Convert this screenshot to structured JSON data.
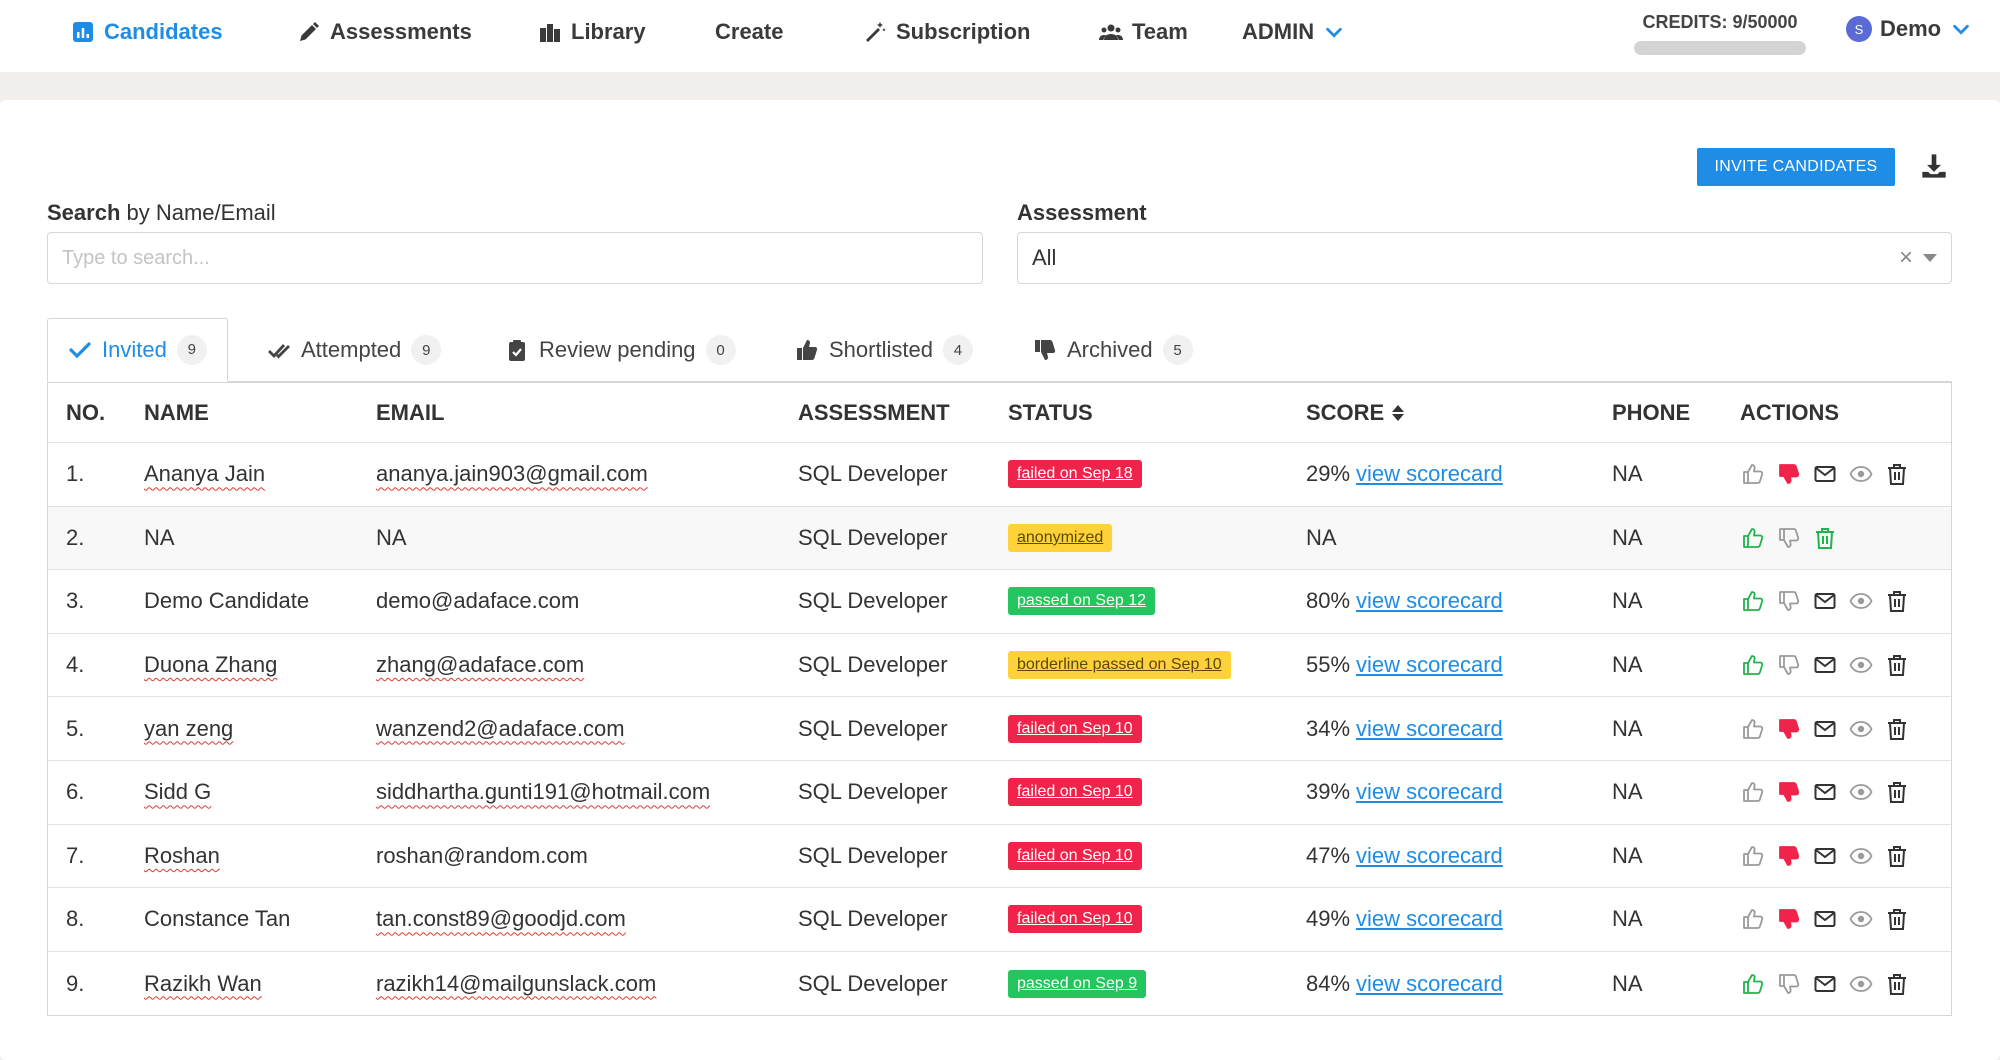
{
  "nav": {
    "items": [
      {
        "label": "Candidates",
        "icon": "bar-chart-icon"
      },
      {
        "label": "Assessments",
        "icon": "pencil-icon"
      },
      {
        "label": "Library",
        "icon": "books-icon"
      },
      {
        "label": "Create",
        "icon": ""
      },
      {
        "label": "Subscription",
        "icon": "magic-wand-icon"
      },
      {
        "label": "Team",
        "icon": "users-icon"
      },
      {
        "label": "ADMIN",
        "icon": "chevron-down-icon"
      }
    ],
    "credits_label": "CREDITS: 9/50000",
    "credits_used": 9,
    "credits_total": 50000,
    "user_initial": "S",
    "user_name": "Demo"
  },
  "toolbar": {
    "invite_label": "INVITE CANDIDATES"
  },
  "filters": {
    "search_label_bold": "Search",
    "search_label_rest": " by Name/Email",
    "search_placeholder": "Type to search...",
    "assessment_label": "Assessment",
    "assessment_value": "All"
  },
  "tabs": [
    {
      "label": "Invited",
      "count": "9",
      "icon": "check-icon"
    },
    {
      "label": "Attempted",
      "count": "9",
      "icon": "double-check-icon"
    },
    {
      "label": "Review pending",
      "count": "0",
      "icon": "clipboard-check-icon"
    },
    {
      "label": "Shortlisted",
      "count": "4",
      "icon": "thumbs-up-icon"
    },
    {
      "label": "Archived",
      "count": "5",
      "icon": "thumbs-down-icon"
    }
  ],
  "table": {
    "headers": {
      "no": "NO.",
      "name": "NAME",
      "email": "EMAIL",
      "assessment": "ASSESSMENT",
      "status": "STATUS",
      "score": "SCORE",
      "phone": "PHONE",
      "actions": "ACTIONS"
    },
    "link_text": "view scorecard",
    "rows": [
      {
        "no": "1.",
        "name": "Ananya Jain",
        "email": "ananya.jain903@gmail.com",
        "assessment": "SQL Developer",
        "status": "failed on Sep 18",
        "status_type": "failed",
        "score": "29%",
        "phone": "NA",
        "up": "gray",
        "down": "red"
      },
      {
        "no": "2.",
        "name": "NA",
        "email": "NA",
        "assessment": "SQL Developer",
        "status": "anonymized",
        "status_type": "anon",
        "score": "NA",
        "phone": "NA",
        "up": "green",
        "down": "gray"
      },
      {
        "no": "3.",
        "name": "Demo Candidate",
        "email": "demo@adaface.com",
        "assessment": "SQL Developer",
        "status": "passed on Sep 12",
        "status_type": "passed",
        "score": "80%",
        "phone": "NA",
        "up": "green",
        "down": "gray"
      },
      {
        "no": "4.",
        "name": "Duona Zhang",
        "email": "zhang@adaface.com",
        "assessment": "SQL Developer",
        "status": "borderline passed on Sep 10",
        "status_type": "border",
        "score": "55%",
        "phone": "NA",
        "up": "green",
        "down": "gray"
      },
      {
        "no": "5.",
        "name": "yan zeng",
        "email": "wanzend2@adaface.com",
        "assessment": "SQL Developer",
        "status": "failed on Sep 10",
        "status_type": "failed",
        "score": "34%",
        "phone": "NA",
        "up": "gray",
        "down": "red"
      },
      {
        "no": "6.",
        "name": "Sidd G",
        "email": "siddhartha.gunti191@hotmail.com",
        "assessment": "SQL Developer",
        "status": "failed on Sep 10",
        "status_type": "failed",
        "score": "39%",
        "phone": "NA",
        "up": "gray",
        "down": "red"
      },
      {
        "no": "7.",
        "name": "Roshan",
        "email": "roshan@random.com",
        "assessment": "SQL Developer",
        "status": "failed on Sep 10",
        "status_type": "failed",
        "score": "47%",
        "phone": "NA",
        "up": "gray",
        "down": "red"
      },
      {
        "no": "8.",
        "name": "Constance Tan",
        "email": "tan.const89@goodjd.com",
        "assessment": "SQL Developer",
        "status": "failed on Sep 10",
        "status_type": "failed",
        "score": "49%",
        "phone": "NA",
        "up": "gray",
        "down": "red"
      },
      {
        "no": "9.",
        "name": "Razikh Wan",
        "email": "razikh14@mailgunslack.com",
        "assessment": "SQL Developer",
        "status": "passed on Sep 9",
        "status_type": "passed",
        "score": "84%",
        "phone": "NA",
        "up": "green",
        "down": "gray"
      }
    ]
  },
  "colors": {
    "accent": "#1f8ce6",
    "failed": "#f0234b",
    "passed": "#24c55e",
    "warning": "#ffd23a",
    "green_icon": "#22b34c",
    "red_icon": "#f0234b",
    "gray_icon": "#9a9a9a"
  }
}
